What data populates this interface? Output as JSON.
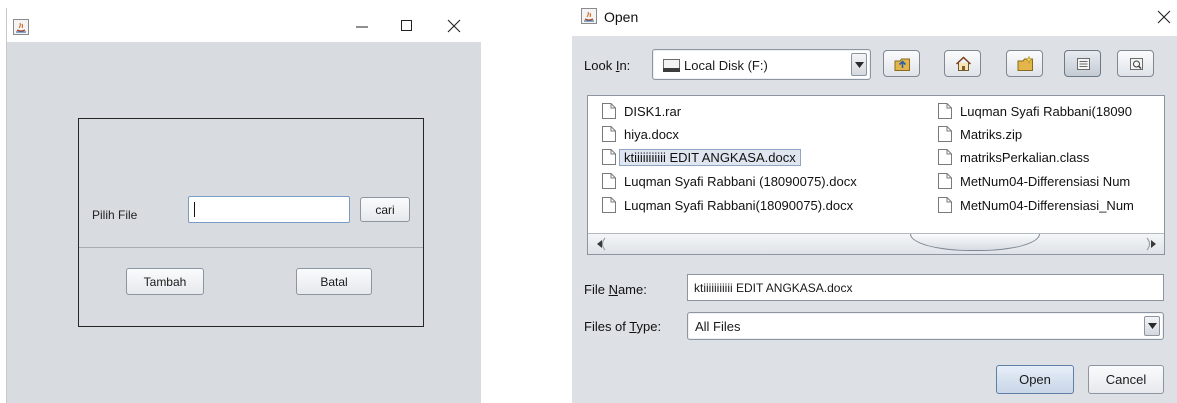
{
  "left_window": {
    "title": "",
    "icons": {
      "app": "java-app-icon",
      "minimize": "minimize-icon",
      "maximize": "maximize-icon",
      "close": "close-icon"
    },
    "form": {
      "pilih_file_label": "Pilih File",
      "file_input_value": "",
      "cari_label": "cari",
      "tambah_label": "Tambah",
      "batal_label": "Batal"
    }
  },
  "open_dialog": {
    "title": "Open",
    "look_in": {
      "label_pre": "Look ",
      "label_mnemonic": "I",
      "label_post": "n:",
      "value": "Local Disk (F:)",
      "icon": "disk-drive-icon"
    },
    "toolbar": [
      "up-one-level-icon",
      "home-icon",
      "new-folder-icon",
      "list-view-icon",
      "details-view-icon"
    ],
    "files_col1": [
      "DISK1.rar",
      "hiya.docx",
      "ktiiiiiiiiiii EDIT ANGKASA.docx",
      "Luqman Syafi Rabbani (18090075).docx",
      "Luqman Syafi Rabbani(18090075).docx"
    ],
    "files_col2": [
      "Luqman Syafi Rabbani(18090",
      "Matriks.zip",
      "matriksPerkalian.class",
      "MetNum04-Differensiasi Num",
      "MetNum04-Differensiasi_Num"
    ],
    "selected_file": "ktiiiiiiiiiii EDIT ANGKASA.docx",
    "file_name": {
      "label_pre": "File ",
      "label_mnemonic": "N",
      "label_post": "ame:",
      "value": "ktiiiiiiiiiii EDIT ANGKASA.docx"
    },
    "files_of_type": {
      "label_pre": "Files of ",
      "label_mnemonic": "T",
      "label_post": "ype:",
      "value": "All Files"
    },
    "open_label": "Open",
    "cancel_label": "Cancel",
    "colors": {
      "background": "#dde1e6",
      "selection": "#dfe6f0",
      "form_bg": "#d8dbe0"
    }
  }
}
